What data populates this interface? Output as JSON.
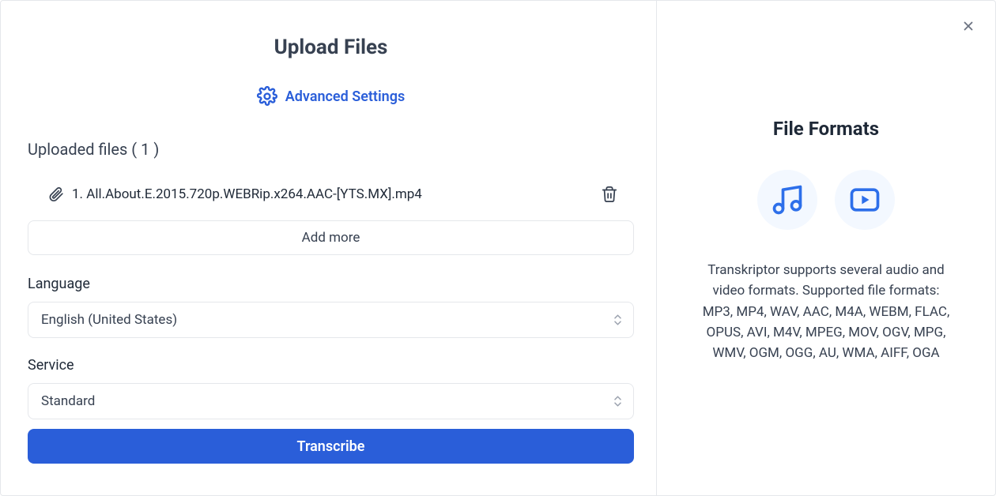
{
  "title": "Upload Files",
  "advanced_settings_label": "Advanced Settings",
  "uploaded_files": {
    "header": "Uploaded files ( 1 )",
    "items": [
      {
        "label": "1. All.About.E.2015.720p.WEBRip.x264.AAC-[YTS.MX].mp4"
      }
    ],
    "add_more_label": "Add more"
  },
  "fields": {
    "language_label": "Language",
    "language_value": "English (United States)",
    "service_label": "Service",
    "service_value": "Standard"
  },
  "submit_label": "Transcribe",
  "right": {
    "title": "File Formats",
    "description": "Transkriptor supports several audio and video formats. Supported file formats: MP3, MP4, WAV, AAC, M4A, WEBM, FLAC, OPUS, AVI, M4V, MPEG, MOV, OGV, MPG, WMV, OGM, OGG, AU, WMA, AIFF, OGA"
  }
}
